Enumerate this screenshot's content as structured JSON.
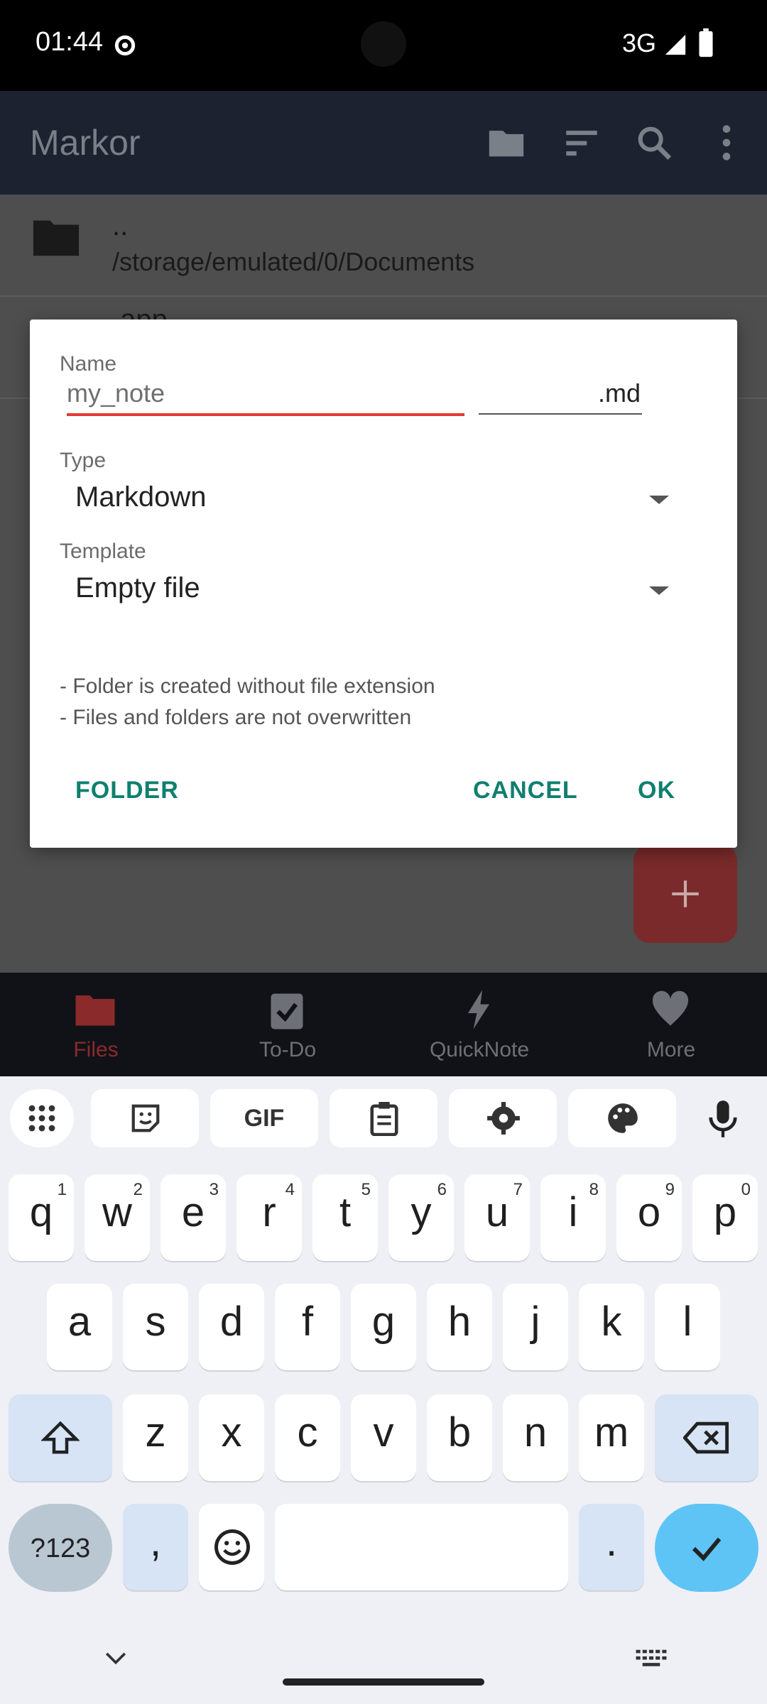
{
  "status": {
    "time": "01:44",
    "network": "3G"
  },
  "app": {
    "title": "Markor"
  },
  "list": {
    "rows": [
      {
        "name": "..",
        "path": "/storage/emulated/0/Documents"
      },
      {
        "name": ".app"
      }
    ]
  },
  "dialog": {
    "name_label": "Name",
    "name_value": "my_note",
    "extension_value": ".md",
    "type_label": "Type",
    "type_value": "Markdown",
    "template_label": "Template",
    "template_value": "Empty file",
    "note1": "- Folder is created without file extension",
    "note2": "- Files and folders are not overwritten",
    "folder_button": "FOLDER",
    "cancel_button": "CANCEL",
    "ok_button": "OK"
  },
  "bottom_nav": [
    {
      "label": "Files",
      "icon": "folder-icon"
    },
    {
      "label": "To-Do",
      "icon": "todo-icon"
    },
    {
      "label": "QuickNote",
      "icon": "bolt-icon"
    },
    {
      "label": "More",
      "icon": "heart-icon"
    }
  ],
  "keyboard": {
    "row1": [
      {
        "c": "q",
        "n": "1"
      },
      {
        "c": "w",
        "n": "2"
      },
      {
        "c": "e",
        "n": "3"
      },
      {
        "c": "r",
        "n": "4"
      },
      {
        "c": "t",
        "n": "5"
      },
      {
        "c": "y",
        "n": "6"
      },
      {
        "c": "u",
        "n": "7"
      },
      {
        "c": "i",
        "n": "8"
      },
      {
        "c": "o",
        "n": "9"
      },
      {
        "c": "p",
        "n": "0"
      }
    ],
    "row2": [
      "a",
      "s",
      "d",
      "f",
      "g",
      "h",
      "j",
      "k",
      "l"
    ],
    "row3": [
      "z",
      "x",
      "c",
      "v",
      "b",
      "n",
      "m"
    ],
    "symbols_key": "?123",
    "comma_key": ",",
    "period_key": "."
  },
  "colors": {
    "accent": "#0f7f6f",
    "error": "#e53935",
    "files_active": "#8b2a2a"
  }
}
